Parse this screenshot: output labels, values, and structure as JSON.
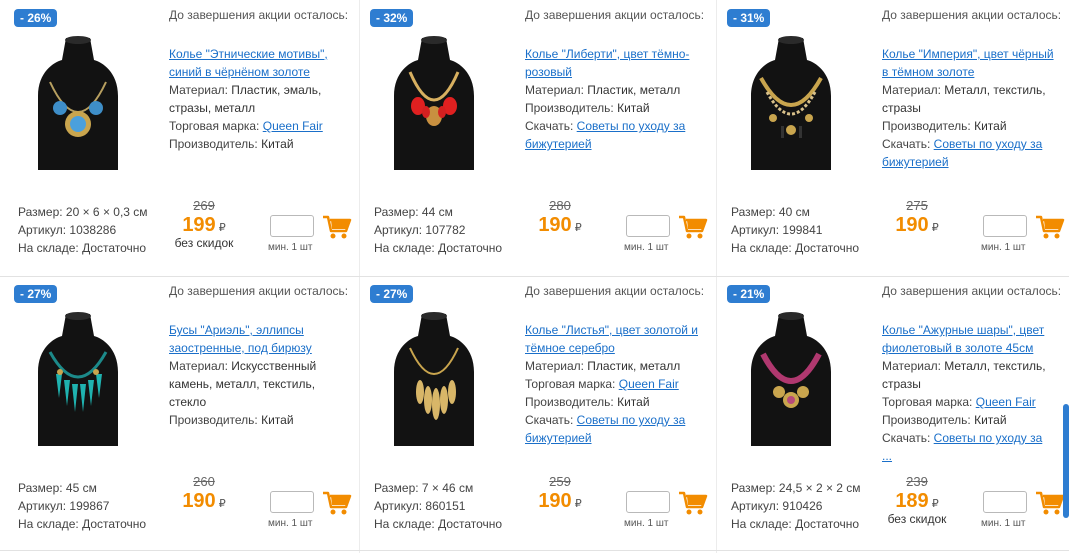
{
  "accent_color": "#2e7dd1",
  "price_color": "#f28c00",
  "link_color": "#1a6fc9",
  "timer_label": "До завершения акции осталось:",
  "min_qty_label": "мин. 1 шт",
  "currency_symbol": "₽",
  "cart_icon": "shopping-cart-icon",
  "products": [
    {
      "discount": "- 26%",
      "title": "Колье \"Этнические мотивы\", синий в чёрнёном золоте",
      "lines": [
        {
          "label": "Материал: ",
          "value": "Пластик, эмаль, стразы, металл",
          "link": ""
        },
        {
          "label": "Торговая марка: ",
          "value": "",
          "link": "Queen Fair"
        },
        {
          "label": "Производитель: ",
          "value": "Китай",
          "link": ""
        }
      ],
      "size": "Размер: 20 × 6 × 0,3 см",
      "article": "Артикул: 1038286",
      "stock": "На складе: Достаточно",
      "old_price": "269",
      "price": "199",
      "note": "без скидок",
      "image": "necklace-blue-ethnic"
    },
    {
      "discount": "- 32%",
      "title": "Колье \"Либерти\", цвет тёмно-розовый",
      "lines": [
        {
          "label": "Материал: ",
          "value": "Пластик, металл",
          "link": ""
        },
        {
          "label": "Производитель: ",
          "value": "Китай",
          "link": ""
        },
        {
          "label": "Скачать: ",
          "value": "",
          "link": "Советы по уходу за бижутерией"
        }
      ],
      "size": "Размер: 44 см",
      "article": "Артикул: 107782",
      "stock": "На складе: Достаточно",
      "old_price": "280",
      "price": "190",
      "note": "",
      "image": "necklace-red-liberty"
    },
    {
      "discount": "- 31%",
      "title": "Колье \"Империя\", цвет чёрный в тёмном золоте",
      "lines": [
        {
          "label": "Материал: ",
          "value": "Металл, текстиль, стразы",
          "link": ""
        },
        {
          "label": "Производитель: ",
          "value": "Китай",
          "link": ""
        },
        {
          "label": "Скачать: ",
          "value": "",
          "link": "Советы по уходу за бижутерией"
        }
      ],
      "size": "Размер: 40 см",
      "article": "Артикул: 199841",
      "stock": "На складе: Достаточно",
      "old_price": "275",
      "price": "190",
      "note": "",
      "image": "necklace-black-empire"
    },
    {
      "discount": "- 27%",
      "title": "Бусы \"Ариэль\", эллипсы заостренные, под бирюзу",
      "lines": [
        {
          "label": "Материал: ",
          "value": "Искусственный камень, металл, текстиль, стекло",
          "link": ""
        },
        {
          "label": "Производитель: ",
          "value": "Китай",
          "link": ""
        }
      ],
      "size": "Размер: 45 см",
      "article": "Артикул: 199867",
      "stock": "На складе: Достаточно",
      "old_price": "260",
      "price": "190",
      "note": "",
      "image": "necklace-turquoise-ariel"
    },
    {
      "discount": "- 27%",
      "title": "Колье \"Листья\", цвет золотой и тёмное серебро",
      "lines": [
        {
          "label": "Материал: ",
          "value": "Пластик, металл",
          "link": ""
        },
        {
          "label": "Торговая марка: ",
          "value": "",
          "link": "Queen Fair"
        },
        {
          "label": "Производитель: ",
          "value": "Китай",
          "link": ""
        },
        {
          "label": "Скачать: ",
          "value": "",
          "link": "Советы по уходу за бижутерией"
        }
      ],
      "size": "Размер: 7 × 46 см",
      "article": "Артикул: 860151",
      "stock": "На складе: Достаточно",
      "old_price": "259",
      "price": "190",
      "note": "",
      "image": "necklace-gold-leaves"
    },
    {
      "discount": "- 21%",
      "title": "Колье \"Ажурные шары\", цвет фиолетовый в золоте 45см",
      "lines": [
        {
          "label": "Материал: ",
          "value": "Металл, текстиль, стразы",
          "link": ""
        },
        {
          "label": "Торговая марка: ",
          "value": "",
          "link": "Queen Fair"
        },
        {
          "label": "Производитель: ",
          "value": "Китай",
          "link": ""
        },
        {
          "label": "Скачать: ",
          "value": "",
          "link": "Советы по уходу за"
        },
        {
          "label": "",
          "value": "",
          "link": "..."
        }
      ],
      "size": "Размер: 24,5 × 2 × 2 см",
      "article": "Артикул: 910426",
      "stock": "На складе: Достаточно",
      "old_price": "239",
      "price": "189",
      "note": "без скидок",
      "image": "necklace-purple-balls"
    }
  ]
}
